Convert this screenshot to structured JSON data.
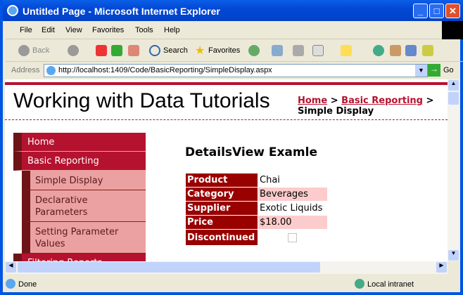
{
  "window": {
    "title": "Untitled Page - Microsoft Internet Explorer"
  },
  "menubar": [
    "File",
    "Edit",
    "View",
    "Favorites",
    "Tools",
    "Help"
  ],
  "toolbar": {
    "back": "Back",
    "search": "Search",
    "favorites": "Favorites"
  },
  "address": {
    "label": "Address",
    "url": "http://localhost:1409/Code/BasicReporting/SimpleDisplay.aspx",
    "go": "Go"
  },
  "page": {
    "site_title": "Working with Data Tutorials",
    "breadcrumb": {
      "home": "Home",
      "section": "Basic Reporting",
      "sep": ">",
      "current": "Simple Display"
    },
    "menu": [
      {
        "label": "Home"
      },
      {
        "label": "Basic Reporting"
      }
    ],
    "submenu": [
      {
        "label": "Simple Display"
      },
      {
        "label": "Declarative Parameters"
      },
      {
        "label": "Setting Parameter Values"
      }
    ],
    "menu_after": {
      "label": "Filtering Reports"
    },
    "heading": "DetailsView Examle",
    "details": [
      {
        "field": "Product",
        "value": "Chai"
      },
      {
        "field": "Category",
        "value": "Beverages"
      },
      {
        "field": "Supplier",
        "value": "Exotic Liquids"
      },
      {
        "field": "Price",
        "value": "$18.00"
      },
      {
        "field": "Discontinued",
        "value": null,
        "checked": false
      }
    ]
  },
  "status": {
    "text": "Done",
    "zone": "Local intranet"
  },
  "colors": {
    "brand": "#b5122f",
    "header_cell": "#990000",
    "alt_row": "#fccccc",
    "submenu": "#eba1a1"
  }
}
